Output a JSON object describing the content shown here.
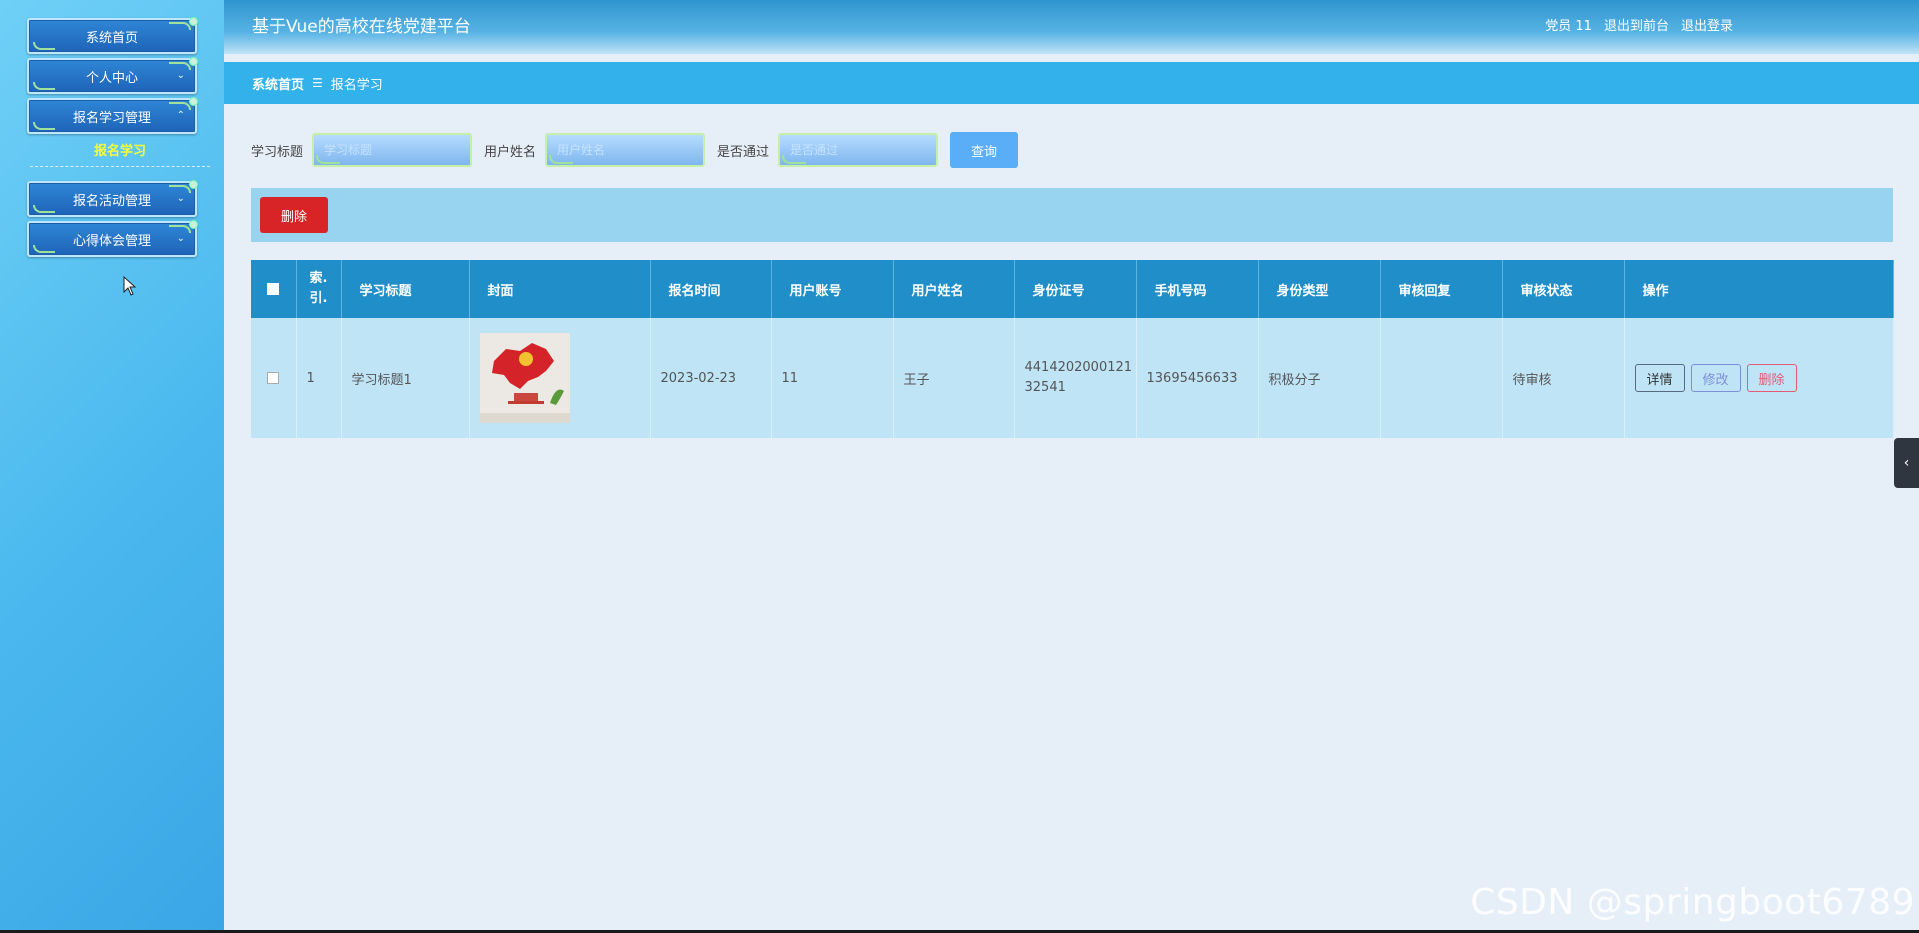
{
  "sidebar": {
    "items": [
      {
        "label": "系统首页"
      },
      {
        "label": "个人中心"
      },
      {
        "label": "报名学习管理"
      },
      {
        "label": "报名活动管理"
      },
      {
        "label": "心得体会管理"
      }
    ],
    "submenu_active": "报名学习"
  },
  "header": {
    "title": "基于Vue的高校在线党建平台",
    "user": "党员 11",
    "back_front": "退出到前台",
    "logout": "退出登录"
  },
  "breadcrumb": {
    "home": "系统首页",
    "separator": "☰",
    "current": "报名学习"
  },
  "search": {
    "title_label": "学习标题",
    "title_placeholder": "学习标题",
    "name_label": "用户姓名",
    "name_placeholder": "用户姓名",
    "pass_label": "是否通过",
    "pass_placeholder": "是否通过",
    "query_label": "查询"
  },
  "actions": {
    "delete_label": "删除"
  },
  "table": {
    "headers": [
      "索引",
      "学习标题",
      "封面",
      "报名时间",
      "用户账号",
      "用户姓名",
      "身份证号",
      "手机号码",
      "身份类型",
      "审核回复",
      "审核状态",
      "操作"
    ],
    "index_header_line1": "索.",
    "index_header_line2": "引.",
    "rows": [
      {
        "index": "1",
        "title": "学习标题1",
        "date": "2023-02-23",
        "account": "11",
        "name": "王子",
        "id_line1": "4414202000121",
        "id_line2": "32541",
        "phone": "13695456633",
        "identity": "积极分子",
        "reply": "",
        "status": "待审核"
      }
    ],
    "op_detail": "详情",
    "op_edit": "修改",
    "op_delete": "删除"
  },
  "icons": {
    "side_tab": "chevron-left-icon"
  },
  "colors": {
    "header_bg": "#2f95cf",
    "crumb_bg": "#33b1ea",
    "table_header": "#1f8ec9",
    "delete_red": "#d82427",
    "submenu_yellow": "#f4ff3a"
  },
  "watermark": "CSDN @springboot6789"
}
